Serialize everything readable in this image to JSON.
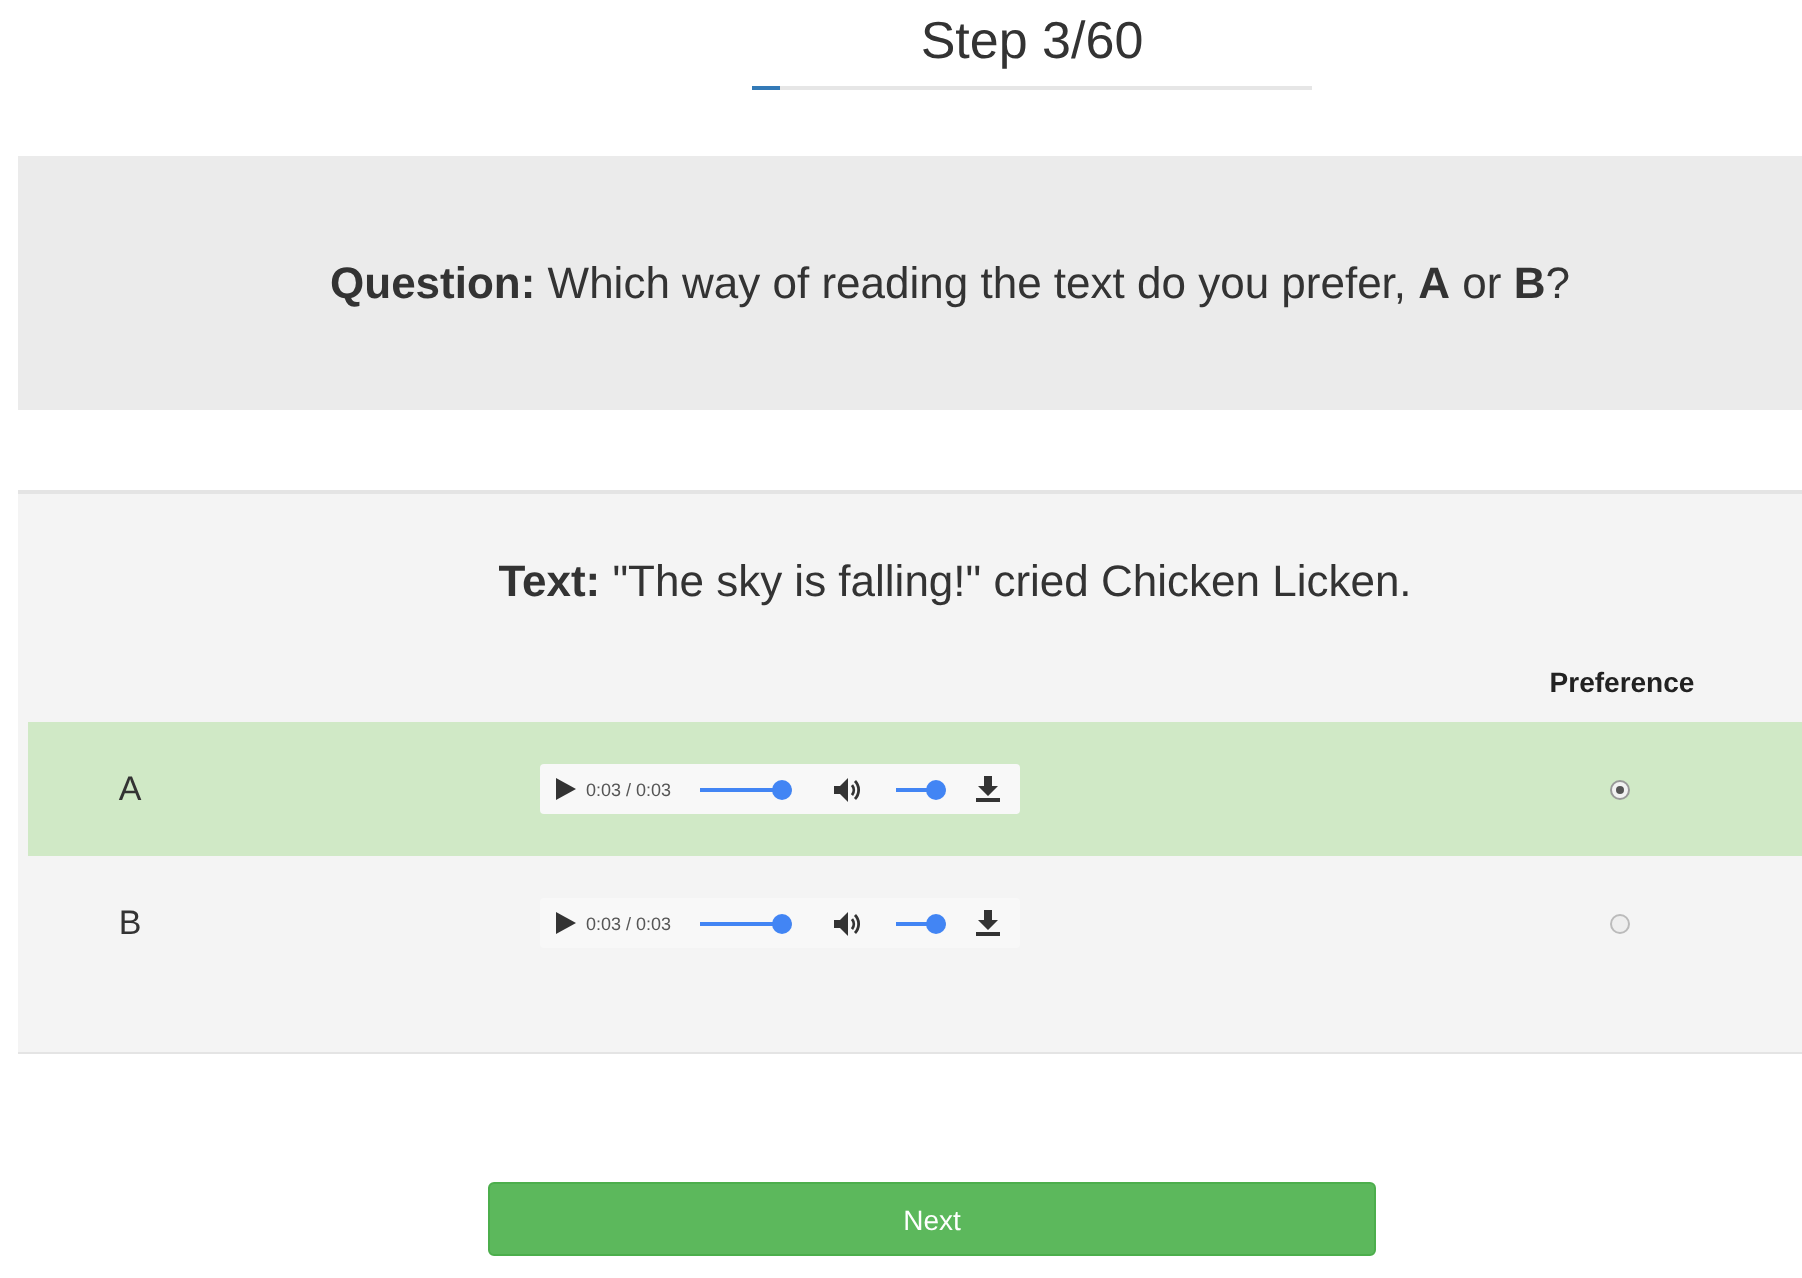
{
  "step": {
    "label": "Step 3/60",
    "level": 0.05
  },
  "question": "**Question:** Which way of reading the text do you prefer, **A** or **B**?",
  "text": "**Text:** \"The sky is falling!\" cried Chicken Licken.",
  "preference_header": "Preference",
  "samples": [
    {
      "label": "A",
      "selected": true,
      "player": {
        "time": "0:03 / 0:03",
        "seek": {
          "level": 1
        },
        "volume": {
          "level": 1
        }
      }
    },
    {
      "label": "B",
      "selected": false,
      "player": {
        "time": "0:03 / 0:03",
        "seek": {
          "level": 1
        },
        "volume": {
          "level": 1
        }
      }
    }
  ],
  "next_button": "Next"
}
